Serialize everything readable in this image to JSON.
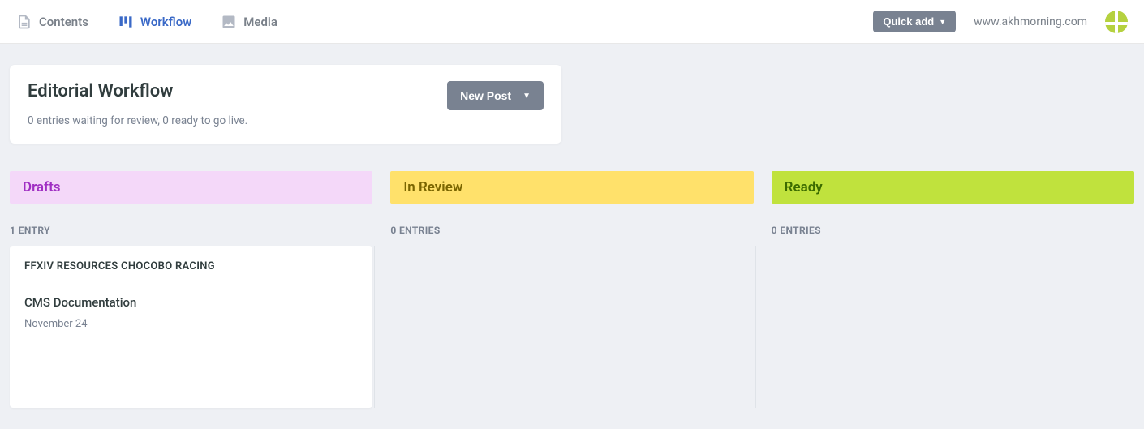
{
  "nav": {
    "contents": "Contents",
    "workflow": "Workflow",
    "media": "Media"
  },
  "topbar": {
    "quick_add": "Quick add",
    "site_url": "www.akhmorning.com"
  },
  "header": {
    "title": "Editorial Workflow",
    "status": "0 entries waiting for review, 0 ready to go live.",
    "new_post": "New Post"
  },
  "columns": {
    "drafts": {
      "label": "Drafts",
      "count": "1 ENTRY"
    },
    "review": {
      "label": "In Review",
      "count": "0 ENTRIES"
    },
    "ready": {
      "label": "Ready",
      "count": "0 ENTRIES"
    }
  },
  "entries": {
    "drafts": [
      {
        "category": "FFXIV RESOURCES CHOCOBO RACING",
        "title": "CMS Documentation",
        "date": "November 24"
      }
    ]
  }
}
